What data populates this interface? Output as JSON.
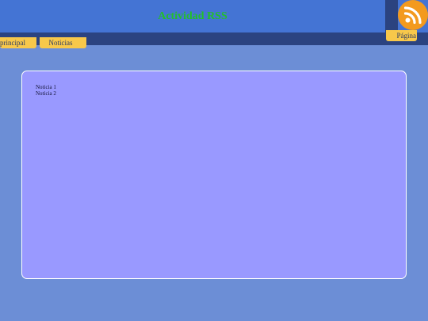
{
  "header": {
    "title": "Actividad RSS",
    "rss_icon": "rss-feed-icon"
  },
  "nav": {
    "tabs": [
      {
        "label": "principal"
      },
      {
        "label": "Noticias"
      },
      {
        "label": "Página"
      }
    ]
  },
  "main": {
    "news": [
      {
        "label": "Noticia 1"
      },
      {
        "label": "Noticia 2"
      }
    ]
  },
  "colors": {
    "header_bg": "#4474d4",
    "nav_bg": "#2b4380",
    "page_bg": "#6c8ed6",
    "tab_bg": "#f8c84a",
    "title_color": "#22c02a",
    "content_bg": "#9999ff",
    "rss_orange": "#f39a1e"
  }
}
